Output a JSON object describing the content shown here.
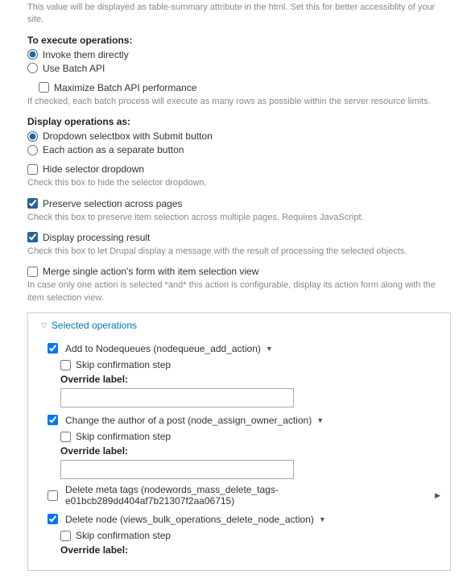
{
  "top_help": "This value will be displayed as table-summary attribute in the html. Set this for better accessiblity of your site.",
  "exec_head": "To execute operations:",
  "exec_opt1": "Invoke them directly",
  "exec_opt2": "Use Batch API",
  "maximize_label": "Maximize Batch API performance",
  "maximize_help": "If checked, each batch process will execute as many rows as possible within the server resource limits.",
  "display_head": "Display operations as:",
  "display_opt1": "Dropdown selectbox with Submit button",
  "display_opt2": "Each action as a separate button",
  "hide_selector": "Hide selector dropdown",
  "hide_selector_help": "Check this box to hide the selector dropdown.",
  "preserve": "Preserve selection across pages",
  "preserve_help": "Check this box to preserve item selection across multiple pages. Requires JavaScript.",
  "display_result": "Display processing result",
  "display_result_help": "Check this box to let Drupal display a message with the result of processing the selected objects.",
  "merge": "Merge single action's form with item selection view",
  "merge_help": "In case only one action is selected *and* this action is configurable, display its action form along with the item selection view.",
  "legend": "Selected operations",
  "skip_label": "Skip confirmation step",
  "override_label": "Override label:",
  "ops": [
    {
      "label": "Add to Nodequeues (nodequeue_add_action)",
      "checked": true,
      "sub": true
    },
    {
      "label": "Change the author of a post (node_assign_owner_action)",
      "checked": true,
      "sub": true
    },
    {
      "label": "Delete meta tags (nodewords_mass_delete_tags-e01bcb289dd404af7b21307f2aa06715)",
      "checked": false,
      "sub": false
    },
    {
      "label": "Delete node (views_bulk_operations_delete_node_action)",
      "checked": true,
      "sub": true
    }
  ]
}
